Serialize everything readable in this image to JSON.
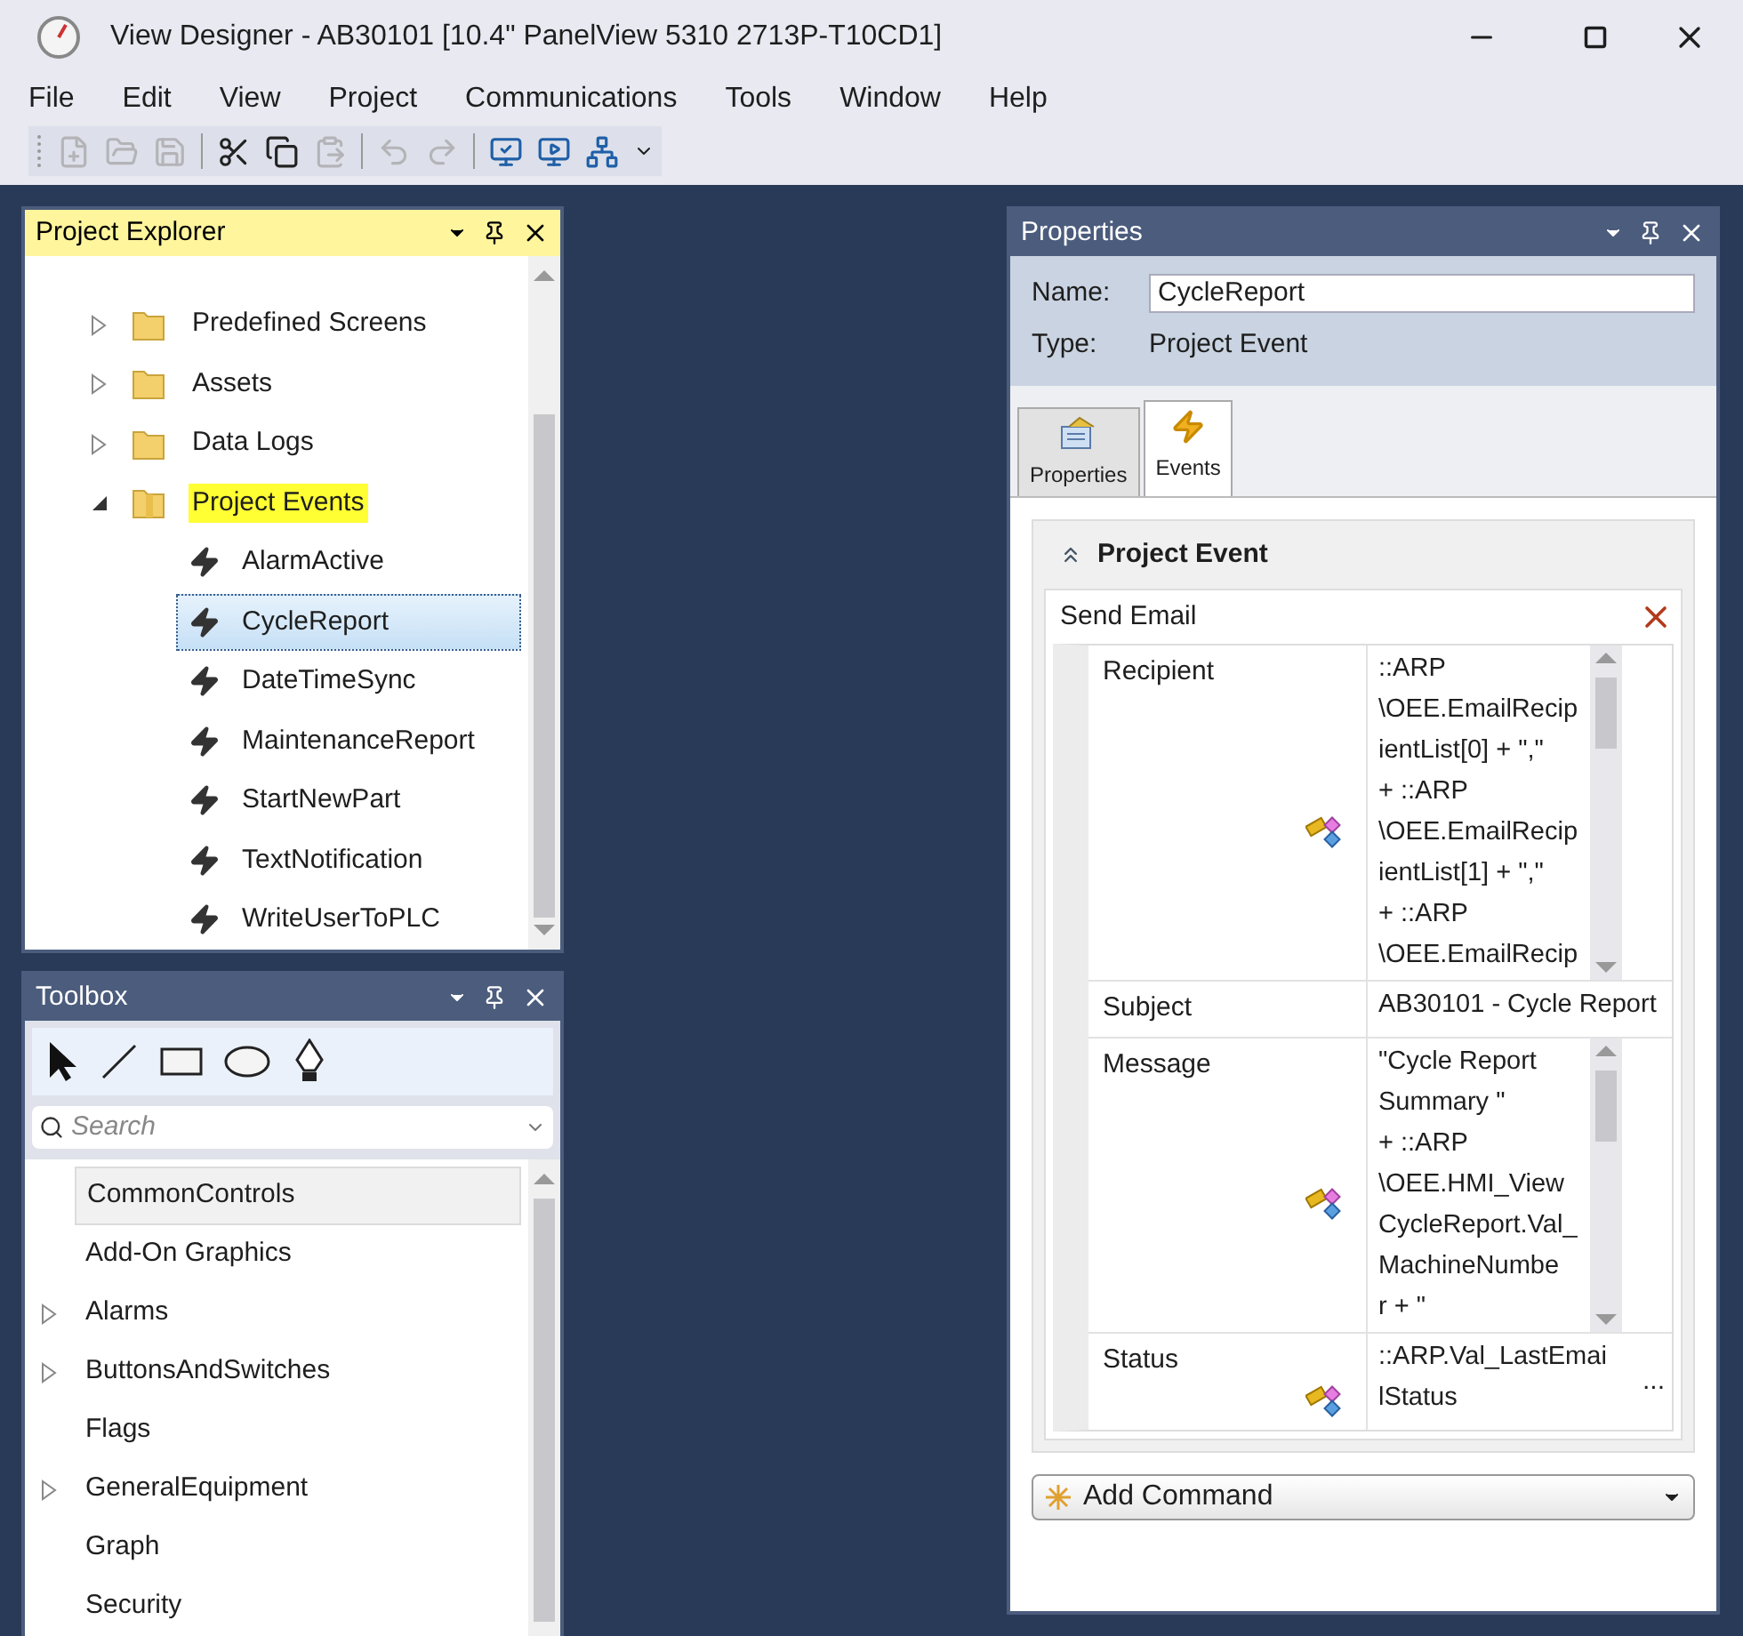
{
  "window": {
    "title": "View Designer - AB30101 [10.4\" PanelView 5310 2713P-T10CD1]"
  },
  "menu": [
    "File",
    "Edit",
    "View",
    "Project",
    "Communications",
    "Tools",
    "Window",
    "Help"
  ],
  "toolbar": [
    {
      "disabled": true
    },
    {
      "disabled": true
    },
    {
      "disabled": true
    },
    {
      "disabled": false
    },
    {
      "disabled": false
    },
    {
      "disabled": true
    },
    {
      "disabled": true
    },
    {
      "disabled": true
    },
    {
      "disabled": false
    },
    {
      "disabled": false
    },
    {
      "disabled": false
    }
  ],
  "project_explorer": {
    "title": "Project Explorer",
    "active": true,
    "items": [
      {
        "label": "Predefined Screens",
        "expanded": false,
        "highlighted": false
      },
      {
        "label": "Assets",
        "expanded": false,
        "highlighted": false
      },
      {
        "label": "Data Logs",
        "expanded": false,
        "highlighted": false
      },
      {
        "label": "Project Events",
        "expanded": true,
        "highlighted": true,
        "children": [
          {
            "label": "AlarmActive",
            "selected": false
          },
          {
            "label": "CycleReport",
            "selected": true
          },
          {
            "label": "DateTimeSync",
            "selected": false
          },
          {
            "label": "MaintenanceReport",
            "selected": false
          },
          {
            "label": "StartNewPart",
            "selected": false
          },
          {
            "label": "TextNotification",
            "selected": false
          },
          {
            "label": "WriteUserToPLC",
            "selected": false
          }
        ]
      }
    ]
  },
  "toolbox": {
    "title": "Toolbox",
    "active": false,
    "search": {
      "placeholder": "Search"
    },
    "items": [
      {
        "label": "CommonControls",
        "selected": true,
        "expandable": false
      },
      {
        "label": "Add-On Graphics",
        "selected": false,
        "expandable": false
      },
      {
        "label": "Alarms",
        "selected": false,
        "expandable": true
      },
      {
        "label": "ButtonsAndSwitches",
        "selected": false,
        "expandable": true
      },
      {
        "label": "Flags",
        "selected": false,
        "expandable": false
      },
      {
        "label": "GeneralEquipment",
        "selected": false,
        "expandable": true
      },
      {
        "label": "Graph",
        "selected": false,
        "expandable": false
      },
      {
        "label": "Security",
        "selected": false,
        "expandable": false
      }
    ]
  },
  "properties": {
    "title": "Properties",
    "active": false,
    "name_label": "Name:",
    "name_value": "CycleReport",
    "type_label": "Type:",
    "type_value": "Project Event",
    "tabs": [
      {
        "label": "Properties",
        "selected": false
      },
      {
        "label": "Events",
        "selected": true
      }
    ],
    "section": {
      "title": "Project Event",
      "expanded": true
    },
    "command": {
      "title": "Send Email",
      "rows": [
        {
          "label": "Recipient",
          "value": "::ARP\n\\OEE.EmailRecip\nientList[0] + \",\"\n+ ::ARP\n\\OEE.EmailRecip\nientList[1] + \",\"\n+ ::ARP\n\\OEE.EmailRecip",
          "bound": true,
          "scrollable": true
        },
        {
          "label": "Subject",
          "value": "AB30101 - Cycle Report",
          "bound": false,
          "scrollable": false
        },
        {
          "label": "Message",
          "value": "\"Cycle Report\nSummary \"\n+ ::ARP\n\\OEE.HMI_View\nCycleReport.Val_\nMachineNumbe\nr + \"",
          "bound": true,
          "scrollable": true
        },
        {
          "label": "Status",
          "value": "::ARP.Val_LastEmai\nlStatus",
          "bound": true,
          "scrollable": false,
          "button": "..."
        }
      ]
    },
    "add_command": "Add Command"
  }
}
